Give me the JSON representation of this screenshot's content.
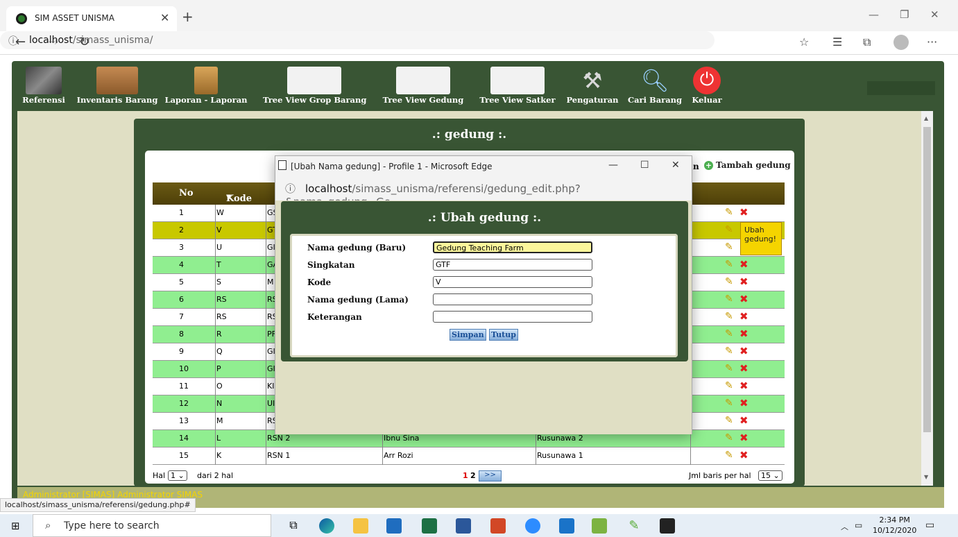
{
  "browser": {
    "tab_title": "SIM ASSET UNISMA",
    "url_host": "localhost",
    "url_path": "/simass_unisma/",
    "status_url": "localhost/simass_unisma/referensi/gedung.php#"
  },
  "menu": [
    {
      "label": "Referensi",
      "icon": "inventory-management-icon"
    },
    {
      "label": "Inventaris Barang",
      "icon": "inventory-boxes-icon"
    },
    {
      "label": "Laporan - Laporan",
      "icon": "file-cabinet-icon"
    },
    {
      "label": "Tree View Grop Barang",
      "icon": "tree-diagram-icon"
    },
    {
      "label": "Tree View Gedung",
      "icon": "tree-diagram-icon"
    },
    {
      "label": "Tree View Satker",
      "icon": "tree-diagram-icon"
    },
    {
      "label": "Pengaturan",
      "icon": "tools-icon"
    },
    {
      "label": "Cari Barang",
      "icon": "magnifier-icon"
    },
    {
      "label": "Keluar",
      "icon": "power-icon"
    }
  ],
  "panel": {
    "title": ".: gedung :.",
    "add_label": "Tambah gedung",
    "hidden_link_suffix": "n"
  },
  "table": {
    "headers": [
      "No",
      "Kode"
    ],
    "rows": [
      {
        "no": "1",
        "kode": "W",
        "c3": "GS",
        "c4": "",
        "c5": ""
      },
      {
        "no": "2",
        "kode": "V",
        "c3": "GT",
        "c4": "",
        "c5": ""
      },
      {
        "no": "3",
        "kode": "U",
        "c3": "GI",
        "c4": "",
        "c5": ""
      },
      {
        "no": "4",
        "kode": "T",
        "c3": "GA",
        "c4": "",
        "c5": ""
      },
      {
        "no": "5",
        "kode": "S",
        "c3": "M",
        "c4": "",
        "c5": ""
      },
      {
        "no": "6",
        "kode": "RS",
        "c3": "RS",
        "c4": "",
        "c5": ""
      },
      {
        "no": "7",
        "kode": "RS",
        "c3": "RS",
        "c4": "",
        "c5": ""
      },
      {
        "no": "8",
        "kode": "R",
        "c3": "PF",
        "c4": "",
        "c5": ""
      },
      {
        "no": "9",
        "kode": "Q",
        "c3": "GI",
        "c4": "",
        "c5": ""
      },
      {
        "no": "10",
        "kode": "P",
        "c3": "GI",
        "c4": "",
        "c5": ""
      },
      {
        "no": "11",
        "kode": "O",
        "c3": "KI",
        "c4": "",
        "c5": ""
      },
      {
        "no": "12",
        "kode": "N",
        "c3": "UI",
        "c4": "",
        "c5": ""
      },
      {
        "no": "13",
        "kode": "M",
        "c3": "RS",
        "c4": "",
        "c5": ""
      },
      {
        "no": "14",
        "kode": "L",
        "c3": "RSN 2",
        "c4": "Ibnu Sina",
        "c5": "Rusunawa 2"
      },
      {
        "no": "15",
        "kode": "K",
        "c3": "RSN 1",
        "c4": "Arr Rozi",
        "c5": "Rusunawa 1"
      }
    ],
    "tooltip": "Ubah gedung!"
  },
  "pagination": {
    "hal_label": "Hal",
    "hal_value": "1",
    "dari_label": "dari 2 hal",
    "page1": "1",
    "page2": "2",
    "next": ">>",
    "rows_label": "Jml baris per hal",
    "rows_value": "15"
  },
  "user_line": "Administrator [SIMAS] Administrator SIMAS",
  "popup": {
    "window_title": "[Ubah Nama gedung] - Profile 1 - Microsoft Edge",
    "url_host": "localhost",
    "url_path": "/simass_unisma/referensi/gedung_edit.php?&nama_gedung=Ge...",
    "title": ".: Ubah gedung :.",
    "fields": [
      {
        "label": "Nama gedung (Baru)",
        "value": "Gedung Teaching Farm"
      },
      {
        "label": "Singkatan",
        "value": "GTF"
      },
      {
        "label": "Kode",
        "value": "V"
      },
      {
        "label": "Nama gedung (Lama)",
        "value": ""
      },
      {
        "label": "Keterangan",
        "value": ""
      }
    ],
    "save_label": "Simpan",
    "close_label": "Tutup"
  },
  "taskbar": {
    "search_placeholder": "Type here to search",
    "time": "2:34 PM",
    "date": "10/12/2020"
  },
  "colors": {
    "header_green": "#395534",
    "row_green": "#90ee90",
    "row_selected": "#c8c800",
    "page_bg": "#e0dfc4"
  }
}
